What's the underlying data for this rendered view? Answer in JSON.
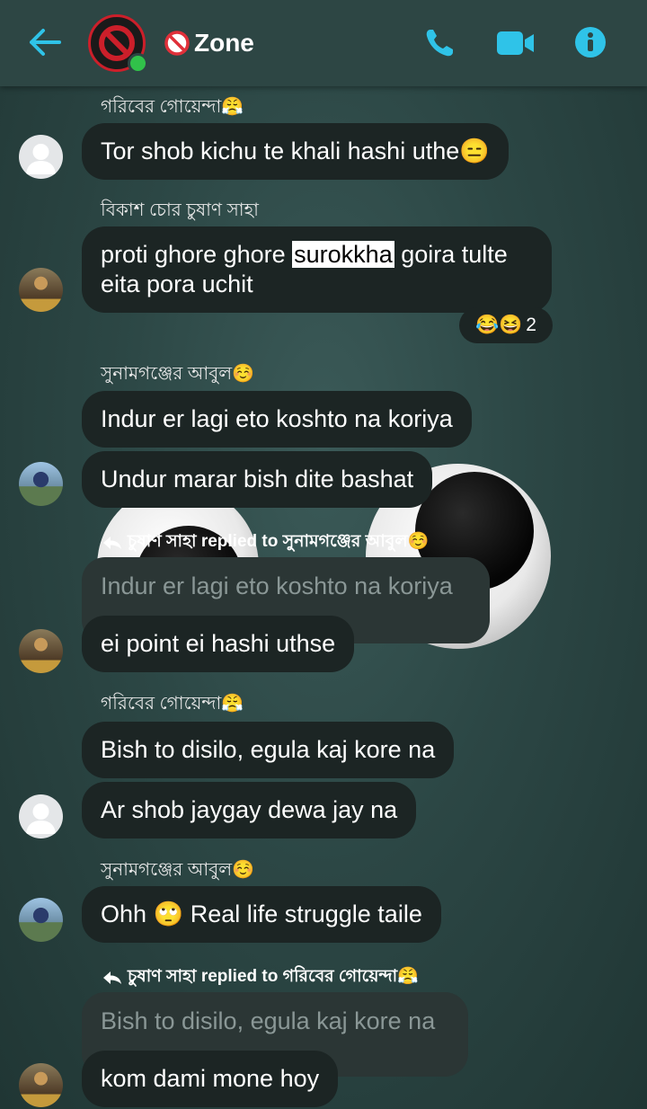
{
  "header": {
    "title": "Zone",
    "back_icon": "arrow-left-icon",
    "call_icon": "phone-icon",
    "video_icon": "video-camera-icon",
    "info_icon": "info-icon",
    "accent_color": "#2fc3e8",
    "title_icon": "no-entry-icon"
  },
  "messages": [
    {
      "sender": "গরিবের গোয়েন্দা😤",
      "text": "Tor shob kichu te khali hashi uthe😑"
    },
    {
      "sender": "বিকাশ চোর চুষাণ সাহা",
      "text_before": "proti ghore ghore",
      "highlight": "surokkha",
      "text_after": "goira tulte",
      "text_line2": "eita pora uchit",
      "reaction_emojis": "😂😆",
      "reaction_count": "2"
    },
    {
      "sender": "সুনামগঞ্জের আবুল☺️",
      "text": "Indur er lagi eto koshto na koriya"
    },
    {
      "text": "Undur marar bish dite bashat"
    },
    {
      "reply_header": "চুষাণ সাহা replied to সুনামগঞ্জের আবুল☺️",
      "quoted": "Indur er lagi eto koshto na koriya",
      "text": "ei point ei hashi uthse"
    },
    {
      "sender": "গরিবের গোয়েন্দা😤",
      "text": "Bish to disilo, egula kaj kore na"
    },
    {
      "text": "Ar shob jaygay dewa jay na"
    },
    {
      "sender": "সুনামগঞ্জের আবুল☺️",
      "text_before": "Ohh",
      "emoji": "🙄",
      "text_after": "Real life struggle taile"
    },
    {
      "reply_header": "চুষাণ সাহা replied to গরিবের গোয়েন্দা😤",
      "quoted": "Bish to disilo, egula kaj kore na",
      "text": "kom dami mone hoy"
    }
  ]
}
